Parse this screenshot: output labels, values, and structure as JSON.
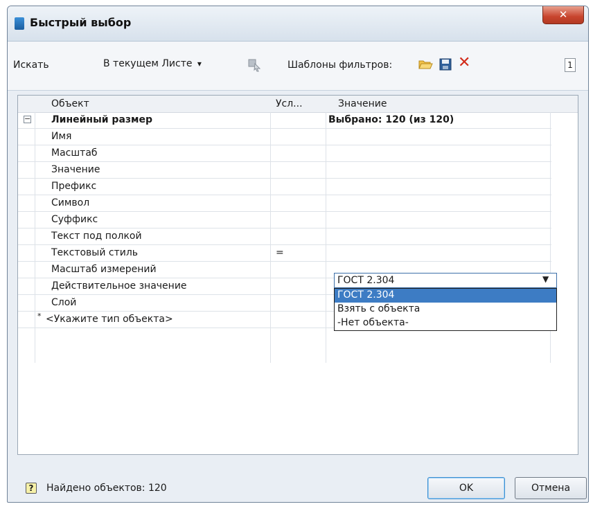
{
  "window": {
    "title": "Быстрый выбор",
    "close_glyph": "✕"
  },
  "toolbar": {
    "search_label": "Искать",
    "scope_label": "В текущем Листе",
    "scope_arrow": "▾",
    "filter_templates_label": "Шаблоны фильтров:",
    "icons": [
      "select-objects-icon",
      "open-folder-icon",
      "save-icon",
      "delete-icon",
      "help-page-icon"
    ],
    "delete_glyph": "✕",
    "page_number": "1"
  },
  "grid": {
    "headers": {
      "object": "Объект",
      "condition": "Усл...",
      "value": "Значение"
    },
    "group": {
      "expander": "−",
      "name": "Линейный размер",
      "value": "Выбрано: 120 (из 120)"
    },
    "rows": [
      {
        "object": "Имя",
        "condition": "",
        "value": ""
      },
      {
        "object": "Масштаб",
        "condition": "",
        "value": ""
      },
      {
        "object": "Значение",
        "condition": "",
        "value": ""
      },
      {
        "object": "Префикс",
        "condition": "",
        "value": ""
      },
      {
        "object": "Символ",
        "condition": "",
        "value": ""
      },
      {
        "object": "Суффикс",
        "condition": "",
        "value": ""
      },
      {
        "object": "Текст под полкой",
        "condition": "",
        "value": ""
      },
      {
        "object": "Текстовый стиль",
        "condition": "=",
        "value": "ГОСТ 2.304"
      },
      {
        "object": "Масштаб измерений",
        "condition": "",
        "value": ""
      },
      {
        "object": "Действительное значение",
        "condition": "",
        "value": ""
      },
      {
        "object": "Слой",
        "condition": "",
        "value": ""
      }
    ],
    "new_row": {
      "marker": "*",
      "object": "<Укажите тип объекта>"
    }
  },
  "dropdown": {
    "selected": "ГОСТ 2.304",
    "arrow": "▼",
    "options": [
      "ГОСТ 2.304",
      "Взять с объекта",
      "-Нет объекта-"
    ]
  },
  "footer": {
    "help_glyph": "?",
    "found_text": "Найдено объектов: 120",
    "ok_label": "OK",
    "cancel_label": "Отмена"
  }
}
